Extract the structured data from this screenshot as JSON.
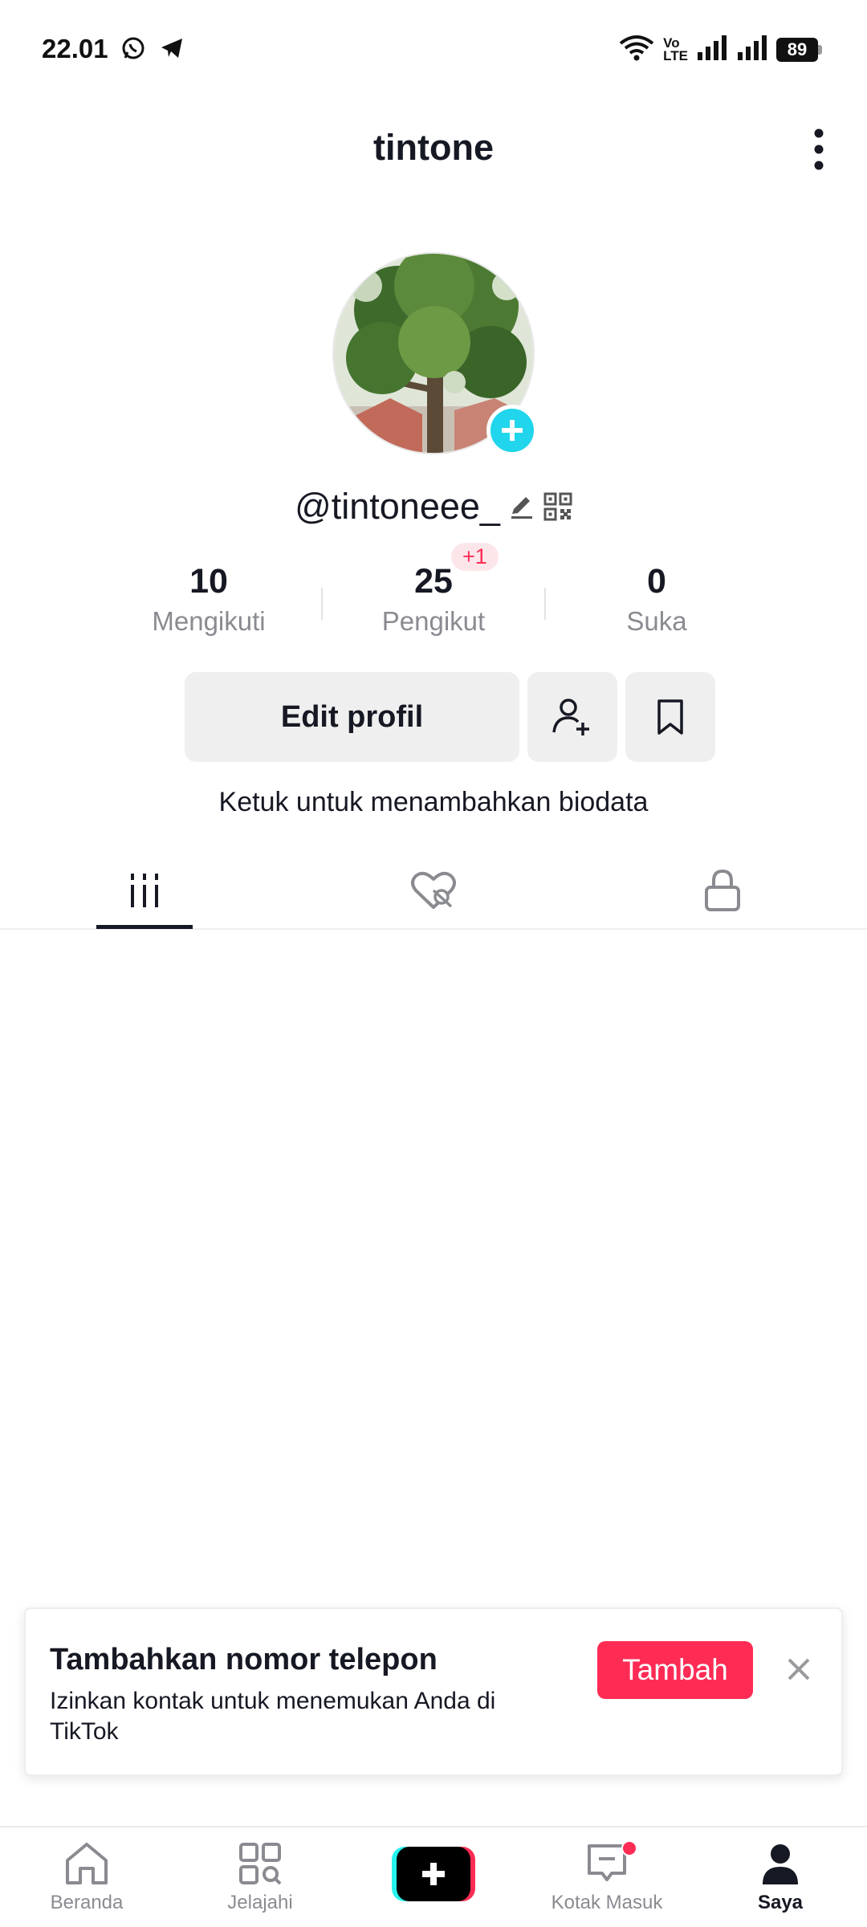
{
  "status_bar": {
    "time": "22.01",
    "network": "Vo\nLTE",
    "battery": "89"
  },
  "header": {
    "title": "tintone"
  },
  "profile": {
    "username": "@tintoneee_",
    "bio_prompt": "Ketuk untuk menambahkan biodata",
    "edit_label": "Edit profil"
  },
  "stats": [
    {
      "value": "10",
      "label": "Mengikuti"
    },
    {
      "value": "25",
      "label": "Pengikut",
      "badge": "+1"
    },
    {
      "value": "0",
      "label": "Suka"
    }
  ],
  "banner": {
    "title": "Tambahkan nomor telepon",
    "text": "Izinkan kontak untuk menemukan Anda di TikTok",
    "button": "Tambah"
  },
  "bottom_nav": [
    {
      "label": "Beranda",
      "icon": "home-icon"
    },
    {
      "label": "Jelajahi",
      "icon": "explore-icon"
    },
    {
      "label": "",
      "icon": "create-icon"
    },
    {
      "label": "Kotak Masuk",
      "icon": "inbox-icon"
    },
    {
      "label": "Saya",
      "icon": "profile-icon"
    }
  ],
  "colors": {
    "accent": "#fe2c55",
    "avatar_add": "#20d5ec",
    "text_primary": "#161823",
    "text_secondary": "#8a8b91"
  }
}
